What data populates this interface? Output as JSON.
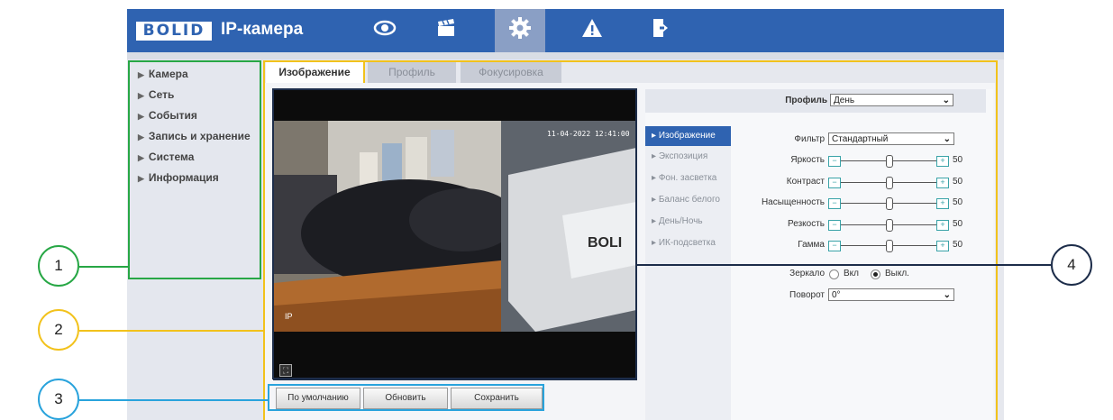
{
  "header": {
    "logo_text": "BOLID",
    "title": "IP-камера",
    "nav": [
      {
        "icon": "eye-icon"
      },
      {
        "icon": "clapperboard-icon"
      },
      {
        "icon": "gear-icon",
        "active": true
      },
      {
        "icon": "warning-icon"
      },
      {
        "icon": "logout-icon"
      }
    ]
  },
  "sidebar": {
    "items": [
      {
        "label": "Камера"
      },
      {
        "label": "Сеть"
      },
      {
        "label": "События"
      },
      {
        "label": "Запись и хранение"
      },
      {
        "label": "Система"
      },
      {
        "label": "Информация"
      }
    ]
  },
  "tabs": [
    {
      "label": "Изображение",
      "active": true
    },
    {
      "label": "Профиль"
    },
    {
      "label": "Фокусировка"
    }
  ],
  "video": {
    "timestamp": "11-04-2022 12:41:00",
    "channel": "IP"
  },
  "image_settings": {
    "profile_label": "Профиль",
    "profile_value": "День",
    "submenu": [
      {
        "label": "Изображение",
        "active": true
      },
      {
        "label": "Экспозиция"
      },
      {
        "label": "Фон. засветка"
      },
      {
        "label": "Баланс белого"
      },
      {
        "label": "День/Ночь"
      },
      {
        "label": "ИК-подсветка"
      }
    ],
    "filter_label": "Фильтр",
    "filter_value": "Стандартный",
    "sliders": [
      {
        "label": "Яркость",
        "value": 50
      },
      {
        "label": "Контраст",
        "value": 50
      },
      {
        "label": "Насыщенность",
        "value": 50
      },
      {
        "label": "Резкость",
        "value": 50
      },
      {
        "label": "Гамма",
        "value": 50
      }
    ],
    "mirror_label": "Зеркало",
    "mirror_on": "Вкл",
    "mirror_off": "Выкл.",
    "mirror_selected": "off",
    "rotate_label": "Поворот",
    "rotate_value": "0°"
  },
  "buttons": {
    "default": "По умолчанию",
    "refresh": "Обновить",
    "save": "Сохранить"
  },
  "callouts": [
    "1",
    "2",
    "3",
    "4"
  ],
  "colors": {
    "header_blue": "#2f63b1",
    "callout_green": "#27a745",
    "callout_yellow": "#f2c21c",
    "callout_blue": "#29a3dc",
    "callout_navy": "#1d2d4a"
  }
}
